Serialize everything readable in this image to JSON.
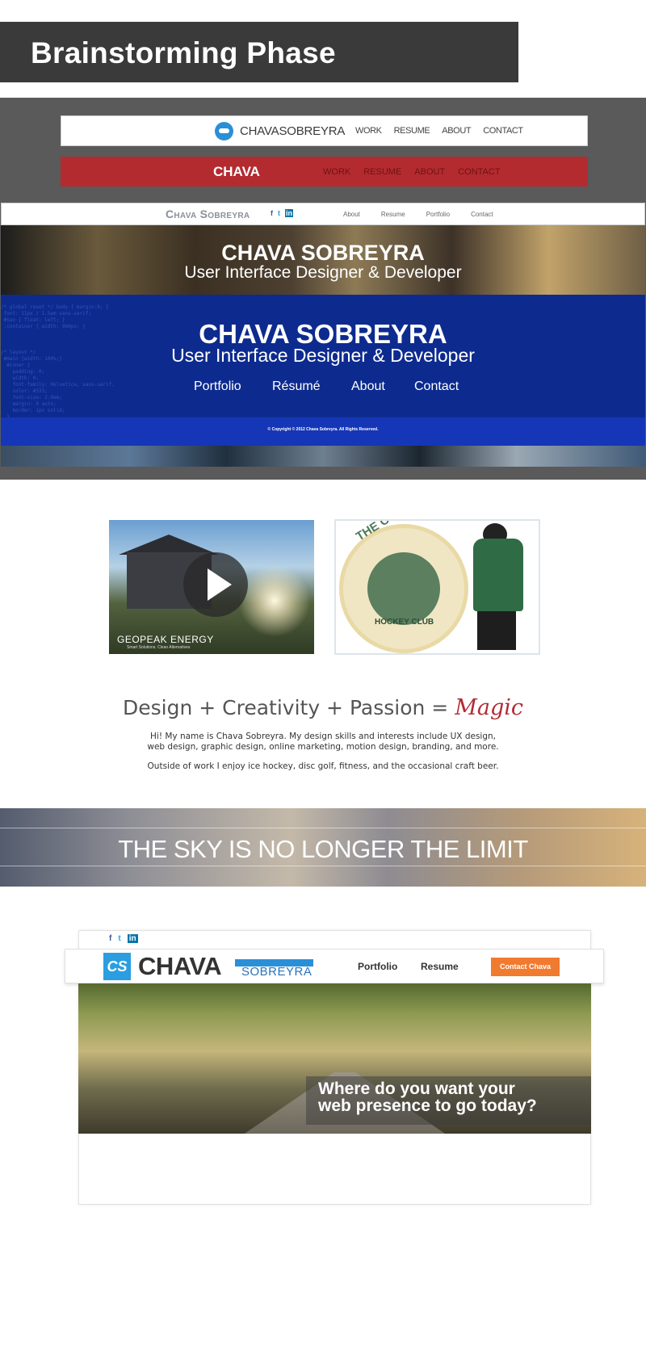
{
  "title": "Brainstorming Phase",
  "mock1": {
    "logo_text": "CHAVASOBREYRA",
    "nav": [
      "WORK",
      "RESUME",
      "ABOUT",
      "CONTACT"
    ]
  },
  "mock2": {
    "logo_text": "CHAVA",
    "nav": [
      "WORK",
      "RESUME",
      "ABOUT",
      "CONTACT"
    ]
  },
  "mock3": {
    "logo_text": "Chava Sobreyra",
    "social": [
      "f",
      "t",
      "in"
    ],
    "nav": [
      "About",
      "Resume",
      "Portfolio",
      "Contact"
    ]
  },
  "hero1": {
    "name": "CHAVA SOBREYRA",
    "subtitle": "User Interface Designer & Developer"
  },
  "hero2": {
    "name": "CHAVA SOBREYRA",
    "subtitle": "User Interface Designer & Developer",
    "nav": [
      "Portfolio",
      "Résumé",
      "About",
      "Contact"
    ],
    "copyright": "© Copyright © 2012 Chava Sobreyra. All Rights Reserved."
  },
  "thumbnails": {
    "video_brand": "GEOPEAK ENERGY",
    "video_tag": "Smart Solutions. Clean Alternatives",
    "hockey_title": "THE COMEBACK KIDS",
    "hockey_sub": "HOCKEY CLUB"
  },
  "tagline": {
    "text": "Design + Creativity + Passion = ",
    "magic": "Magic"
  },
  "bio": {
    "line1": "Hi! My name is Chava Sobreyra. My design skills and interests include UX design,",
    "line2": "web design, graphic design, online marketing, motion design, branding, and more.",
    "line3": "Outside of work I enjoy ice hockey, disc golf, fitness, and the occasional craft beer."
  },
  "sky_banner": "THE SKY IS NO LONGER THE LIMIT",
  "mock4": {
    "social": [
      "f",
      "t",
      "in"
    ],
    "logo_mark": "CS",
    "logo_main": "CHAVA",
    "logo_sub": "SOBREYRA",
    "nav": [
      "Portfolio",
      "Resume"
    ],
    "cta": "Contact Chava",
    "hero_caption_line1": "Where do you want your",
    "hero_caption_line2": "web presence to go today?"
  },
  "colors": {
    "banner": "#3a3a3a",
    "panel_grey": "#5a5a5a",
    "red_header": "#b32b2f",
    "blue_hero": "#0d2b8f",
    "magic": "#b32a35",
    "cta_orange": "#f07a2f",
    "logo_blue": "#2a9ee0"
  }
}
